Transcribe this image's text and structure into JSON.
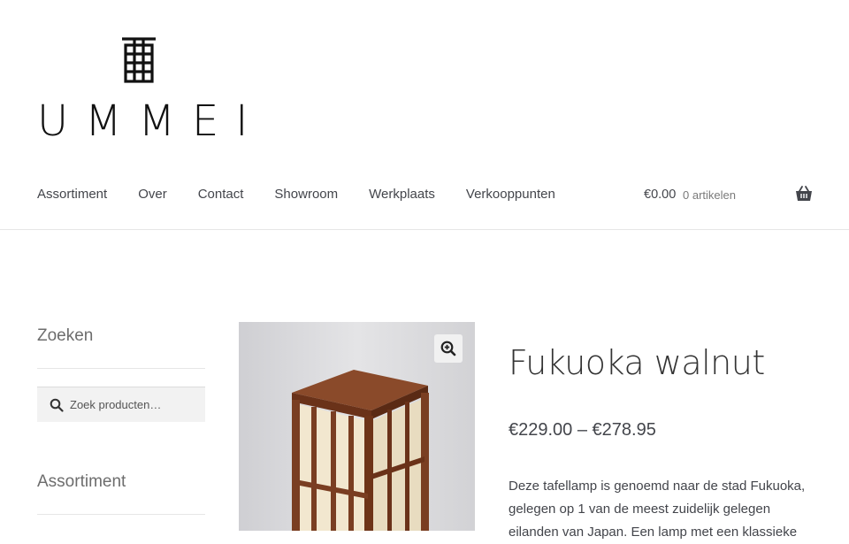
{
  "brand": {
    "name": "UMMEI"
  },
  "nav": {
    "items": [
      {
        "label": "Assortiment"
      },
      {
        "label": "Over"
      },
      {
        "label": "Contact"
      },
      {
        "label": "Showroom"
      },
      {
        "label": "Werkplaats"
      },
      {
        "label": "Verkooppunten"
      }
    ]
  },
  "cart": {
    "amount": "€0.00",
    "count": "0 artikelen",
    "icon": "basket-icon"
  },
  "sidebar": {
    "search_title": "Zoeken",
    "search_placeholder": "Zoek producten…",
    "category_title": "Assortiment"
  },
  "product": {
    "title": "Fukuoka walnut",
    "price": "€229.00 – €278.95",
    "description": "Deze tafellamp is genoemd naar de stad Fukuoka, gelegen op 1 van de meest zuidelijk gelegen eilanden van Japan. Een lamp met een klassieke"
  },
  "colors": {
    "text": "#43454b",
    "wood": "#7a3e22",
    "rule": "#e6e6e6"
  }
}
